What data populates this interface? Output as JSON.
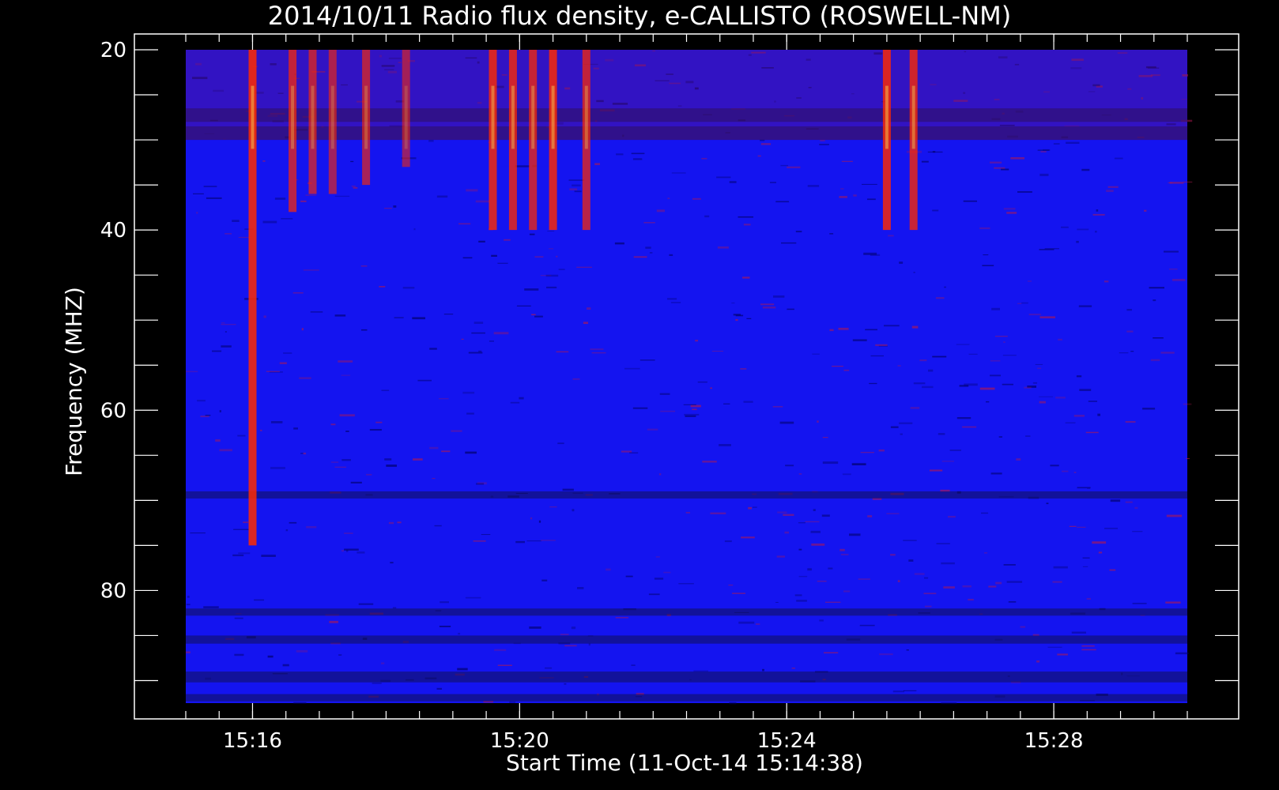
{
  "chart_data": {
    "type": "heatmap",
    "title": "2014/10/11  Radio flux density, e-CALLISTO (ROSWELL-NM)",
    "xlabel": "Start Time (11-Oct-14 15:14:38)",
    "ylabel": "Frequency (MHZ)",
    "x_ticks": [
      "15:16",
      "15:20",
      "15:24",
      "15:28"
    ],
    "y_ticks": [
      "20",
      "40",
      "60",
      "80"
    ],
    "x_range_minutes": [
      15.0,
      30.0
    ],
    "y_range_mhz": [
      20,
      92.5
    ],
    "y_axis_inverted": true,
    "colormap": "blue-red-yellow",
    "background_color": "#1414f0",
    "burst_color": "#ff2a00",
    "peak_color": "#ffff60",
    "bursts": [
      {
        "time_min": 16.0,
        "freq_low_mhz": 20,
        "freq_high_mhz": 75,
        "intensity": 1.0
      },
      {
        "time_min": 16.6,
        "freq_low_mhz": 20,
        "freq_high_mhz": 38,
        "intensity": 0.7
      },
      {
        "time_min": 16.9,
        "freq_low_mhz": 20,
        "freq_high_mhz": 36,
        "intensity": 0.6
      },
      {
        "time_min": 17.2,
        "freq_low_mhz": 20,
        "freq_high_mhz": 36,
        "intensity": 0.5
      },
      {
        "time_min": 17.7,
        "freq_low_mhz": 20,
        "freq_high_mhz": 35,
        "intensity": 0.55
      },
      {
        "time_min": 18.3,
        "freq_low_mhz": 20,
        "freq_high_mhz": 33,
        "intensity": 0.4
      },
      {
        "time_min": 19.6,
        "freq_low_mhz": 20,
        "freq_high_mhz": 40,
        "intensity": 0.9
      },
      {
        "time_min": 19.9,
        "freq_low_mhz": 20,
        "freq_high_mhz": 40,
        "intensity": 0.85
      },
      {
        "time_min": 20.2,
        "freq_low_mhz": 20,
        "freq_high_mhz": 40,
        "intensity": 0.75
      },
      {
        "time_min": 20.5,
        "freq_low_mhz": 20,
        "freq_high_mhz": 40,
        "intensity": 0.95
      },
      {
        "time_min": 21.0,
        "freq_low_mhz": 20,
        "freq_high_mhz": 40,
        "intensity": 0.7
      },
      {
        "time_min": 25.5,
        "freq_low_mhz": 20,
        "freq_high_mhz": 40,
        "intensity": 0.95
      },
      {
        "time_min": 25.9,
        "freq_low_mhz": 20,
        "freq_high_mhz": 40,
        "intensity": 0.85
      }
    ]
  }
}
